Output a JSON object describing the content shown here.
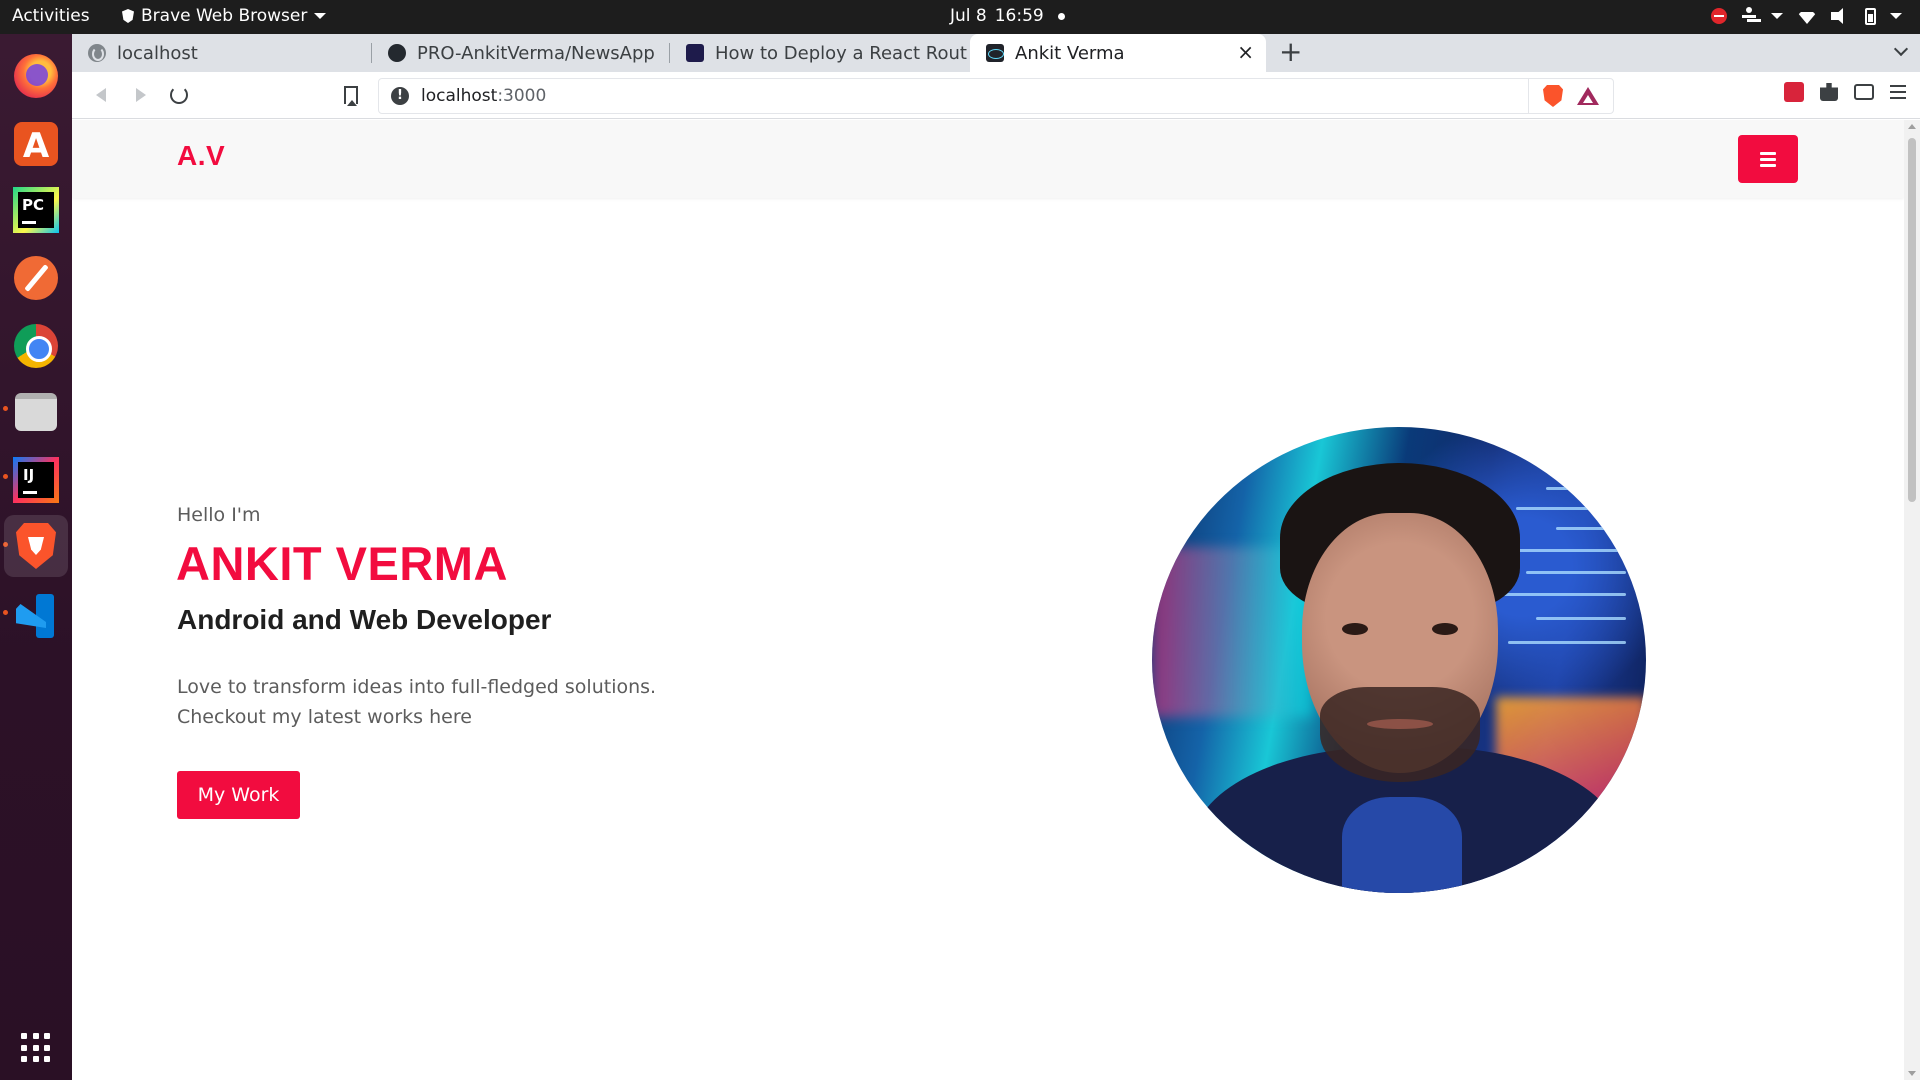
{
  "system_bar": {
    "activities": "Activities",
    "app_name": "Brave Web Browser",
    "date": "Jul 8",
    "time": "16:59"
  },
  "dock": {
    "apps": [
      "firefox",
      "ubuntu-software",
      "pycharm",
      "text-editor",
      "chrome",
      "files",
      "intellij-idea",
      "brave",
      "vscode",
      "show-applications"
    ]
  },
  "browser": {
    "tabs": [
      {
        "title": "localhost",
        "active": false
      },
      {
        "title": "PRO-AnkitVerma/NewsApp",
        "active": false
      },
      {
        "title": "How to Deploy a React Router",
        "active": false
      },
      {
        "title": "Ankit Verma",
        "active": true
      }
    ],
    "new_tab": "+",
    "close_tab": "×",
    "address": {
      "host": "localhost",
      "port": ":3000"
    }
  },
  "site": {
    "brand": "A.V",
    "hero": {
      "greeting": "Hello I'm",
      "name": "ANKIT VERMA",
      "role": "Android and Web Developer",
      "description_line1": "Love to transform ideas into full-fledged solutions.",
      "description_line2": "Checkout my latest works here",
      "cta": "My Work"
    },
    "colors": {
      "accent": "#f20c3f",
      "nav_bg": "#f8f8f8",
      "heading": "#1f1f1f",
      "body_text": "#5c5c5c"
    }
  }
}
